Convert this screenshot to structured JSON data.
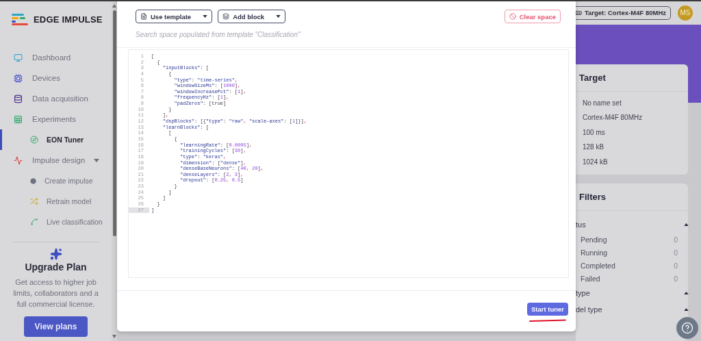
{
  "sidebar": {
    "brand": "EDGE IMPULSE",
    "items": [
      {
        "label": "Dashboard",
        "kind": "item",
        "selected": false
      },
      {
        "label": "Devices",
        "kind": "item",
        "selected": false
      },
      {
        "label": "Data acquisition",
        "kind": "item",
        "selected": false
      },
      {
        "label": "Experiments",
        "kind": "item",
        "selected": false
      },
      {
        "label": "EON Tuner",
        "kind": "subitem",
        "selected": true
      },
      {
        "label": "Impulse design",
        "kind": "item",
        "selected": false,
        "expanded": true
      },
      {
        "label": "Create impulse",
        "kind": "subitem",
        "selected": false
      },
      {
        "label": "Retrain model",
        "kind": "subitem",
        "selected": false
      },
      {
        "label": "Live classification",
        "kind": "subitem",
        "selected": false
      }
    ],
    "upgrade": {
      "title": "Upgrade Plan",
      "text": "Get access to higher job limits, collaborators and a full commercial license.",
      "button": "View plans"
    }
  },
  "header": {
    "target_button": "Target: Cortex-M4F 80MHz",
    "avatar": "MS"
  },
  "target_card": {
    "title": "Target",
    "rows": [
      "No name set",
      "Cortex-M4F 80MHz",
      "100 ms",
      "128 kB",
      "1024 kB"
    ]
  },
  "filters_card": {
    "title": "Filters",
    "groups": [
      {
        "label": "tus",
        "expanded": true,
        "options": [
          {
            "label": "Pending",
            "count": "0"
          },
          {
            "label": "Running",
            "count": "0"
          },
          {
            "label": "Completed",
            "count": "0"
          },
          {
            "label": "Failed",
            "count": "0"
          }
        ]
      },
      {
        "label": "type",
        "expanded": true
      },
      {
        "label": "del type",
        "expanded": true
      }
    ]
  },
  "modal": {
    "buttons": [
      "Use template",
      "Add block"
    ],
    "clear_button": "Clear space",
    "hint": "Search space populated from template \"Classification\"",
    "primary_button": "Start tuner",
    "code_lines": [
      {
        "number": "1",
        "active": false,
        "text": "["
      },
      {
        "number": "2",
        "active": false,
        "text": "  {"
      },
      {
        "number": "3",
        "active": false,
        "text": "    \"inputBlocks\": ["
      },
      {
        "number": "4",
        "active": false,
        "text": "      {"
      },
      {
        "number": "5",
        "active": false,
        "text": "        \"type\": \"time-series\","
      },
      {
        "number": "6",
        "active": false,
        "text": "        \"windowSizeMs\": [1000],"
      },
      {
        "number": "7",
        "active": false,
        "text": "        \"windowIncreasePct\": [1],"
      },
      {
        "number": "8",
        "active": false,
        "text": "        \"frequencyHz\": [1],"
      },
      {
        "number": "9",
        "active": false,
        "text": "        \"padZeros\": [true]"
      },
      {
        "number": "10",
        "active": false,
        "text": "      }"
      },
      {
        "number": "11",
        "active": false,
        "text": "    ],"
      },
      {
        "number": "12",
        "active": false,
        "text": "    \"dspBlocks\": [{\"type\": \"raw\", \"scale-axes\": [1]}],"
      },
      {
        "number": "13",
        "active": false,
        "text": "    \"learnBlocks\": ["
      },
      {
        "number": "14",
        "active": false,
        "text": "      ["
      },
      {
        "number": "15",
        "active": false,
        "text": "        {"
      },
      {
        "number": "16",
        "active": false,
        "text": "          \"learningRate\": [0.0005],"
      },
      {
        "number": "17",
        "active": false,
        "text": "          \"trainingCycles\": [30],"
      },
      {
        "number": "18",
        "active": false,
        "text": "          \"type\": \"keras\","
      },
      {
        "number": "19",
        "active": false,
        "text": "          \"dimension\": [\"dense\"],"
      },
      {
        "number": "20",
        "active": false,
        "text": "          \"denseBaseNeurons\": [40, 20],"
      },
      {
        "number": "21",
        "active": false,
        "text": "          \"denseLayers\": [2, 3],"
      },
      {
        "number": "22",
        "active": false,
        "text": "          \"dropout\": [0.25, 0.5]"
      },
      {
        "number": "23",
        "active": false,
        "text": "        }"
      },
      {
        "number": "24",
        "active": false,
        "text": "      ]"
      },
      {
        "number": "25",
        "active": false,
        "text": "    ]"
      },
      {
        "number": "26",
        "active": false,
        "text": "  }"
      },
      {
        "number": "27",
        "active": true,
        "text": "]"
      }
    ]
  }
}
